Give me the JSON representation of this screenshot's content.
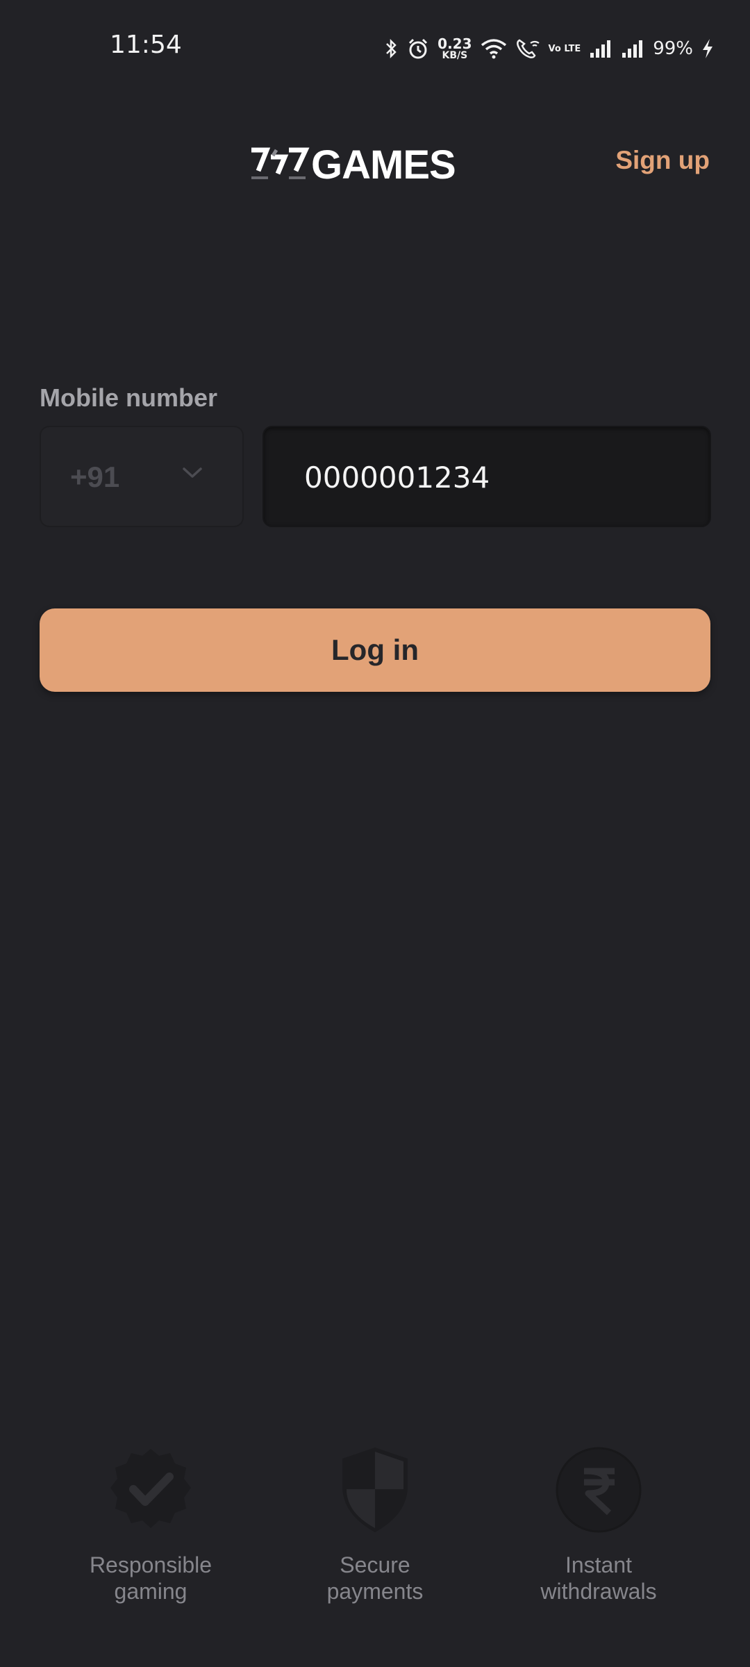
{
  "status_bar": {
    "time": "11:54",
    "net_speed_value": "0.23",
    "net_speed_unit": "KB/S",
    "volte": "Vo LTE",
    "battery": "99%"
  },
  "header": {
    "logo_text": "GAMES",
    "signup_label": "Sign up"
  },
  "form": {
    "mobile_label": "Mobile number",
    "country_code": "+91",
    "phone_value": "0000001234",
    "login_label": "Log in"
  },
  "features": [
    {
      "icon": "badge-check-icon",
      "line1": "Responsible",
      "line2": "gaming"
    },
    {
      "icon": "shield-icon",
      "line1": "Secure",
      "line2": "payments"
    },
    {
      "icon": "rupee-coin-icon",
      "line1": "Instant",
      "line2": "withdrawals"
    }
  ],
  "colors": {
    "background": "#222226",
    "accent": "#e2a277",
    "input_bg": "#19191b",
    "label": "#a5a5aa"
  }
}
